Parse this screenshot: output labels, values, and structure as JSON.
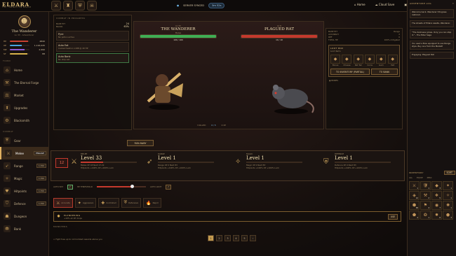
{
  "app": {
    "title": "ELDARA",
    "subtitle": "THE FORGOTTEN REALM"
  },
  "topbar": {
    "status_label": "SERVER SYNCED",
    "status_pill": "3m 52s",
    "nav": {
      "home": "Home",
      "cloud": "Cloud Save",
      "save": "Save",
      "help": "Help",
      "exit": "Exit"
    },
    "icons": [
      "sword-icon",
      "helmet-icon",
      "shield-icon",
      "skull-icon"
    ]
  },
  "player": {
    "name": "The Wanderer",
    "level": "Lv 33",
    "role": "Adventurer",
    "bars": [
      {
        "label": "HP",
        "value": "4840",
        "pct": 0.93,
        "color": "#c9412f"
      },
      {
        "label": "XP",
        "value": "1,116,045",
        "pct": 0.6,
        "color": "#4aa3df"
      },
      {
        "label": "MP",
        "value": "2,990",
        "pct": 0.75,
        "color": "#8f5bd6"
      },
      {
        "label": "ST",
        "value": "88",
        "pct": 0.88,
        "color": "#d8b24a"
      }
    ]
  },
  "sidebar": {
    "section_town": "TOWN",
    "town": [
      "Home",
      "The Eternal Forge",
      "Market",
      "Upgrades",
      "Blacksmith"
    ],
    "section_combat": "COMBAT",
    "combat": [
      {
        "label": "Gear",
        "tag": ""
      },
      {
        "label": "Melee",
        "tag": "ENGAGE",
        "active": true
      },
      {
        "label": "Range",
        "tag": "1,700"
      },
      {
        "label": "Magic",
        "tag": "1,700"
      },
      {
        "label": "Hitpoints",
        "tag": "1,700"
      },
      {
        "label": "Defence",
        "tag": "1,700"
      },
      {
        "label": "Dungeon",
        "tag": ""
      },
      {
        "label": "Bank",
        "tag": ""
      }
    ]
  },
  "combat": {
    "header": "COMBAT IN PROGRESS",
    "left_stats": [
      {
        "k": "BASE HIT",
        "v": "24"
      },
      {
        "k": "BLOCK",
        "v": "63%"
      }
    ],
    "left_rows": [
      {
        "t": "Pyre",
        "s": "No potion active"
      },
      {
        "t": "Auto Eat",
        "s": "Cooked Salmon x188 @ 40 HP"
      },
      {
        "t": "Auto Bank",
        "s": "No drop set"
      }
    ],
    "player": {
      "tag": "LV 33",
      "name": "THE WANDERER",
      "sub": "Melee",
      "hp": "100 / 100",
      "hp_pct": 1.0
    },
    "enemy": {
      "tag": "LV 8",
      "name": "PLAGUED RAT",
      "sub": "",
      "hp": "10 / 10",
      "hp_pct": 1.0
    },
    "enemy_stats": [
      {
        "k": "BASE HIT",
        "v": "Range"
      },
      {
        "k": "ACCURACY",
        "v": "2"
      },
      {
        "k": "DEF",
        "v": "0"
      },
      {
        "k": "TOTAL HP",
        "v": "100% mitigated"
      }
    ],
    "loot": {
      "title": "LOOT BOX",
      "sub": "Loot items",
      "items": [
        "Bones",
        "Cheese",
        "Rat Tail",
        "Coins",
        "Gem",
        "Pelt"
      ],
      "btn_inventory": "TO INVENTORY (PARTIAL)",
      "btn_bank": "TO BANK"
    },
    "bones_label": "BONES",
    "progress": {
      "left": "3 KILLED",
      "mid": "0 / 5",
      "right": "0 XP"
    },
    "run_away": "RUN AWAY"
  },
  "skills": [
    {
      "tag": "MELEE",
      "level": "Level 33",
      "xp": "Melee XP  18  Next  17.2k",
      "bonus": "Hitpoints +100% XP  +100% Luck",
      "num": "12"
    },
    {
      "tag": "RANGE",
      "level": "Level 1",
      "xp": "Range XP  0  Next  83",
      "bonus": "Hitpoints +100% XP  +100% Luck"
    },
    {
      "tag": "MAGIC",
      "level": "Level 1",
      "xp": "Magic XP  0  Next  83",
      "bonus": "Hitpoints +100% XP  +100% Luck"
    },
    {
      "tag": "DEFENCE",
      "level": "Level 1",
      "xp": "Defence XP  0  Next  83",
      "bonus": "Hitpoints +100% XP  +100% Luck"
    }
  ],
  "controls": {
    "auto_eat": "AUTO EAT",
    "threshold": "HP THRESHOLD",
    "auto_loot": "AUTO LOOT"
  },
  "styles": {
    "labels": [
      "Accurate",
      "Aggressive",
      "Controlled",
      "Defensive",
      "Rapid"
    ]
  },
  "buff": {
    "title": "PLUNDERING",
    "sub": "+10% all XP drops",
    "btn": "USE"
  },
  "monsters": {
    "header": "MONSTERS",
    "hint": "Fight foes up to roll Combat rewards above you"
  },
  "pager": [
    "1",
    "2",
    "3",
    "4",
    "5",
    "›"
  ],
  "adventure_log": {
    "title": "ADVENTURE LOG",
    "entries": [
      "Welcome back, Wanderer! Progress restored.",
      "The streets of Eldara awaits, Wanderer.",
      "\"The darkness grows. Only you can stop it.\" - The Elder Sage",
      "You used a Bow equipped to use Range style. Buy one from the Market!",
      "Engaging: Plagued Rat"
    ]
  },
  "inventory": {
    "title": "INVENTORY",
    "btn": "SORT",
    "tabs": [
      "ALL",
      "EQUIP",
      "MISC"
    ],
    "slots": [
      {
        "icon": "⚔",
        "n": "1"
      },
      {
        "icon": "🛡",
        "n": "1"
      },
      {
        "icon": "◆",
        "n": "3"
      },
      {
        "icon": "✦",
        "n": "1"
      },
      {
        "icon": "◈",
        "n": "12"
      },
      {
        "icon": "⚒",
        "n": "2"
      },
      {
        "icon": "❖",
        "n": "5"
      },
      {
        "icon": "✧",
        "n": "1"
      },
      {
        "icon": "⬢",
        "n": "99"
      },
      {
        "icon": "⚑",
        "n": "4"
      },
      {
        "icon": "◉",
        "n": "7"
      },
      {
        "icon": "✺",
        "n": "1"
      },
      {
        "icon": "⬟",
        "n": "2"
      },
      {
        "icon": "❂",
        "n": "1"
      },
      {
        "icon": "✹",
        "n": "6"
      },
      {
        "icon": "⬣",
        "n": "3"
      }
    ]
  },
  "colors": {
    "accent": "#e1b160",
    "hp": "#3fae54",
    "enemy_hp": "#c4392d"
  }
}
